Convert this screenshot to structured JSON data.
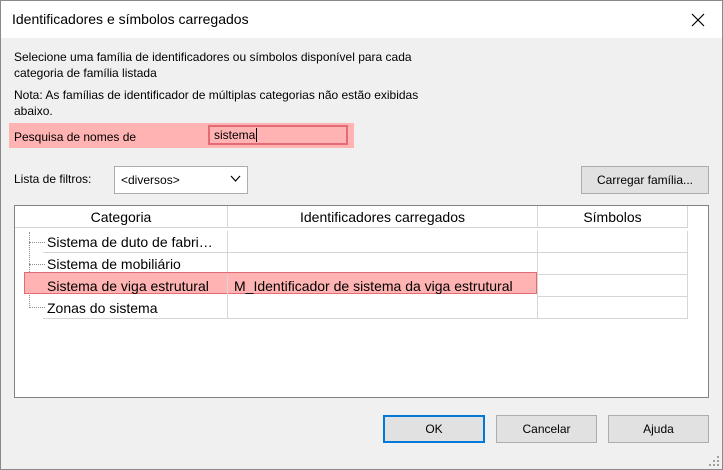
{
  "window": {
    "title": "Identificadores e símbolos carregados"
  },
  "instructions": {
    "line1": "Selecione uma família de identificadores ou símbolos disponível para cada",
    "line2": "categoria de família listada",
    "note1": "Nota: As famílias de identificador de múltiplas categorias não estão exibidas",
    "note2": "abaixo."
  },
  "search": {
    "label": "Pesquisa de nomes de",
    "value": "sistema"
  },
  "filter": {
    "label": "Lista de filtros:",
    "selected": "<diversos>"
  },
  "load_family_label": "Carregar família...",
  "table": {
    "headers": [
      "Categoria",
      "Identificadores carregados",
      "Símbolos"
    ],
    "rows": [
      {
        "category": "Sistema de duto de fabri…",
        "tag": "",
        "symbol": ""
      },
      {
        "category": "Sistema de mobiliário",
        "tag": "",
        "symbol": ""
      },
      {
        "category": "Sistema de viga estrutural",
        "tag": "M_Identificador de sistema da viga estrutural",
        "symbol": ""
      },
      {
        "category": "Zonas do sistema",
        "tag": "",
        "symbol": ""
      }
    ]
  },
  "buttons": {
    "ok": "OK",
    "cancel": "Cancelar",
    "help": "Ajuda"
  },
  "colors": {
    "highlight": "#ffb3b3",
    "highlight_border": "#e46a74",
    "default_button_border": "#0078d7"
  },
  "icons": {
    "close": "close-icon",
    "dropdown": "chevron-down-icon"
  }
}
